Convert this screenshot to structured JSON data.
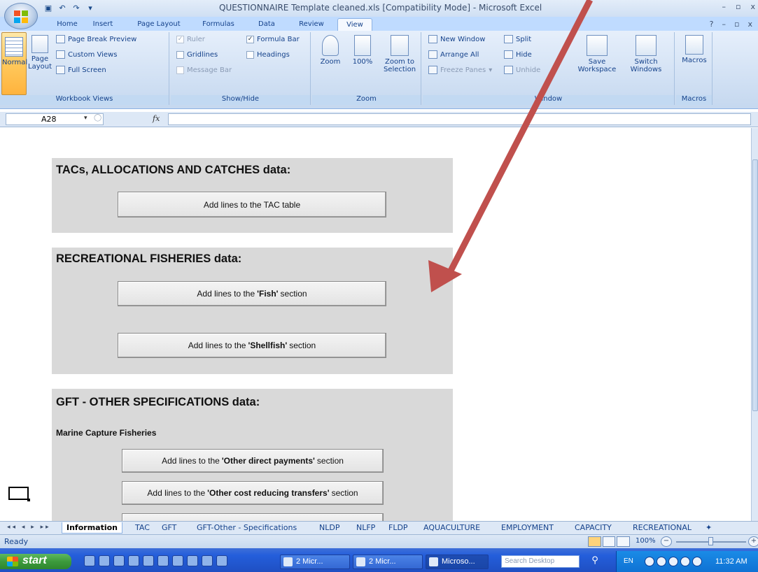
{
  "window": {
    "title": "QUESTIONNAIRE Template cleaned.xls  [Compatibility Mode] - Microsoft Excel",
    "controls": [
      "–",
      "▫",
      "x"
    ]
  },
  "quick_access": [
    "save",
    "undo",
    "redo",
    "customize"
  ],
  "ribbon_tabs": [
    "Home",
    "Insert",
    "Page Layout",
    "Formulas",
    "Data",
    "Review",
    "View"
  ],
  "active_tab": "View",
  "ribbon": {
    "workbook_views": {
      "label": "Workbook Views",
      "normal": "Normal",
      "page_layout": "Page Layout",
      "page_break_preview": "Page Break Preview",
      "custom_views": "Custom Views",
      "full_screen": "Full Screen"
    },
    "show_hide": {
      "label": "Show/Hide",
      "ruler": "Ruler",
      "formula_bar": "Formula Bar",
      "gridlines": "Gridlines",
      "headings": "Headings",
      "message_bar": "Message Bar"
    },
    "zoom": {
      "label": "Zoom",
      "zoom": "Zoom",
      "hundred": "100%",
      "zoom_to_selection": "Zoom to Selection"
    },
    "window": {
      "label": "Window",
      "new_window": "New Window",
      "arrange_all": "Arrange All",
      "freeze_panes": "Freeze Panes",
      "split": "Split",
      "hide": "Hide",
      "unhide": "Unhide",
      "save_workspace": "Save Workspace",
      "switch_windows": "Switch Windows"
    },
    "macros": {
      "label": "Macros",
      "macros": "Macros"
    }
  },
  "formula_bar": {
    "name_box": "A28",
    "fx": "fx",
    "value": ""
  },
  "sheet": {
    "tac_panel": {
      "heading": "TACs, ALLOCATIONS AND CATCHES data:",
      "button": "Add lines to the TAC table"
    },
    "recreational_panel": {
      "heading": "RECREATIONAL FISHERIES data:",
      "fish_button": {
        "prefix": "Add lines to the",
        "bold": "'Fish'",
        "suffix": "section"
      },
      "shellfish_button": {
        "prefix": "Add lines to the",
        "bold": "'Shellfish'",
        "suffix": "section"
      }
    },
    "gft_panel": {
      "heading": "GFT - OTHER SPECIFICATIONS data:",
      "subheading": "Marine Capture Fisheries",
      "other_direct_button": {
        "prefix": "Add lines to the",
        "bold": "'Other direct payments'",
        "suffix": "section"
      },
      "other_cost_button": {
        "prefix": "Add lines to the",
        "bold": "'Other cost reducing transfers'",
        "suffix": "section"
      }
    }
  },
  "sheet_tabs": [
    "Information",
    "TAC",
    "GFT",
    "GFT-Other - Specifications",
    "NLDP",
    "NLFP",
    "FLDP",
    "AQUACULTURE",
    "EMPLOYMENT",
    "CAPACITY",
    "RECREATIONAL"
  ],
  "active_sheet": "Information",
  "status": {
    "ready": "Ready",
    "zoom": "100%",
    "zoom_level_percent": 100
  },
  "taskbar": {
    "start": "start",
    "items": [
      "2 Micr...",
      "2 Micr...",
      "Microso..."
    ],
    "search_placeholder": "Search Desktop",
    "language": "EN",
    "clock": "11:32 AM"
  },
  "annotation": {
    "arrow_color": "#c0504d"
  }
}
